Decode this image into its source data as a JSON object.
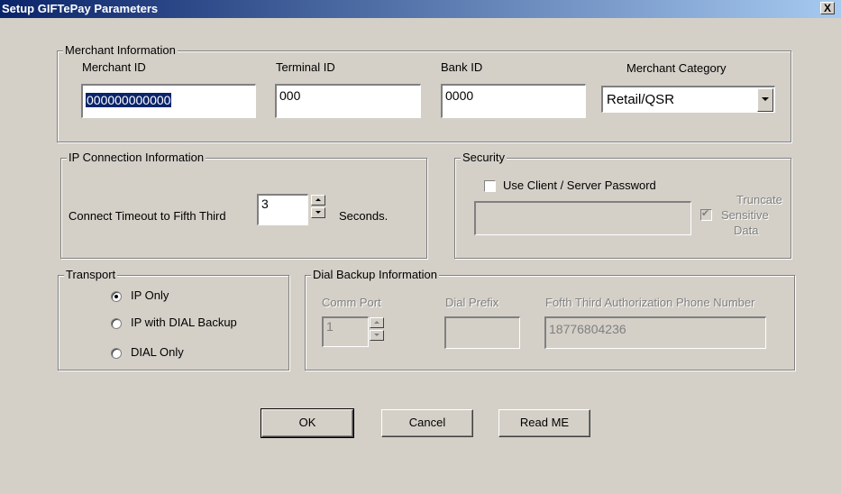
{
  "window": {
    "title": "Setup GIFTePay Parameters",
    "close_glyph": "X"
  },
  "merchant": {
    "legend": "Merchant Information",
    "merchant_id_label": "Merchant ID",
    "merchant_id_value": "000000000000",
    "terminal_id_label": "Terminal ID",
    "terminal_id_value": "000",
    "bank_id_label": "Bank ID",
    "bank_id_value": "0000",
    "category_label": "Merchant Category",
    "category_value": "Retail/QSR"
  },
  "ip": {
    "legend": "IP Connection  Information",
    "timeout_label": "Connect Timeout to Fifth Third",
    "timeout_value": "3",
    "seconds_label": "Seconds."
  },
  "security": {
    "legend": "Security",
    "use_password_label": "Use Client / Server Password",
    "use_password_checked": false,
    "password_value": "",
    "truncate_label_1": "Truncate",
    "truncate_label_2": "Sensitive",
    "truncate_label_3": "Data",
    "truncate_checked": true
  },
  "transport": {
    "legend": "Transport",
    "options": [
      {
        "label": "IP Only",
        "selected": true
      },
      {
        "label": "IP with DIAL Backup",
        "selected": false
      },
      {
        "label": "DIAL Only",
        "selected": false
      }
    ]
  },
  "dial": {
    "legend": "Dial Backup Information",
    "comm_port_label": "Comm Port",
    "comm_port_value": "1",
    "dial_prefix_label": "Dial Prefix",
    "dial_prefix_value": "",
    "phone_label": "Fofth Third Authorization Phone Number",
    "phone_value": "18776804236"
  },
  "buttons": {
    "ok": "OK",
    "cancel": "Cancel",
    "readme": "Read ME"
  }
}
